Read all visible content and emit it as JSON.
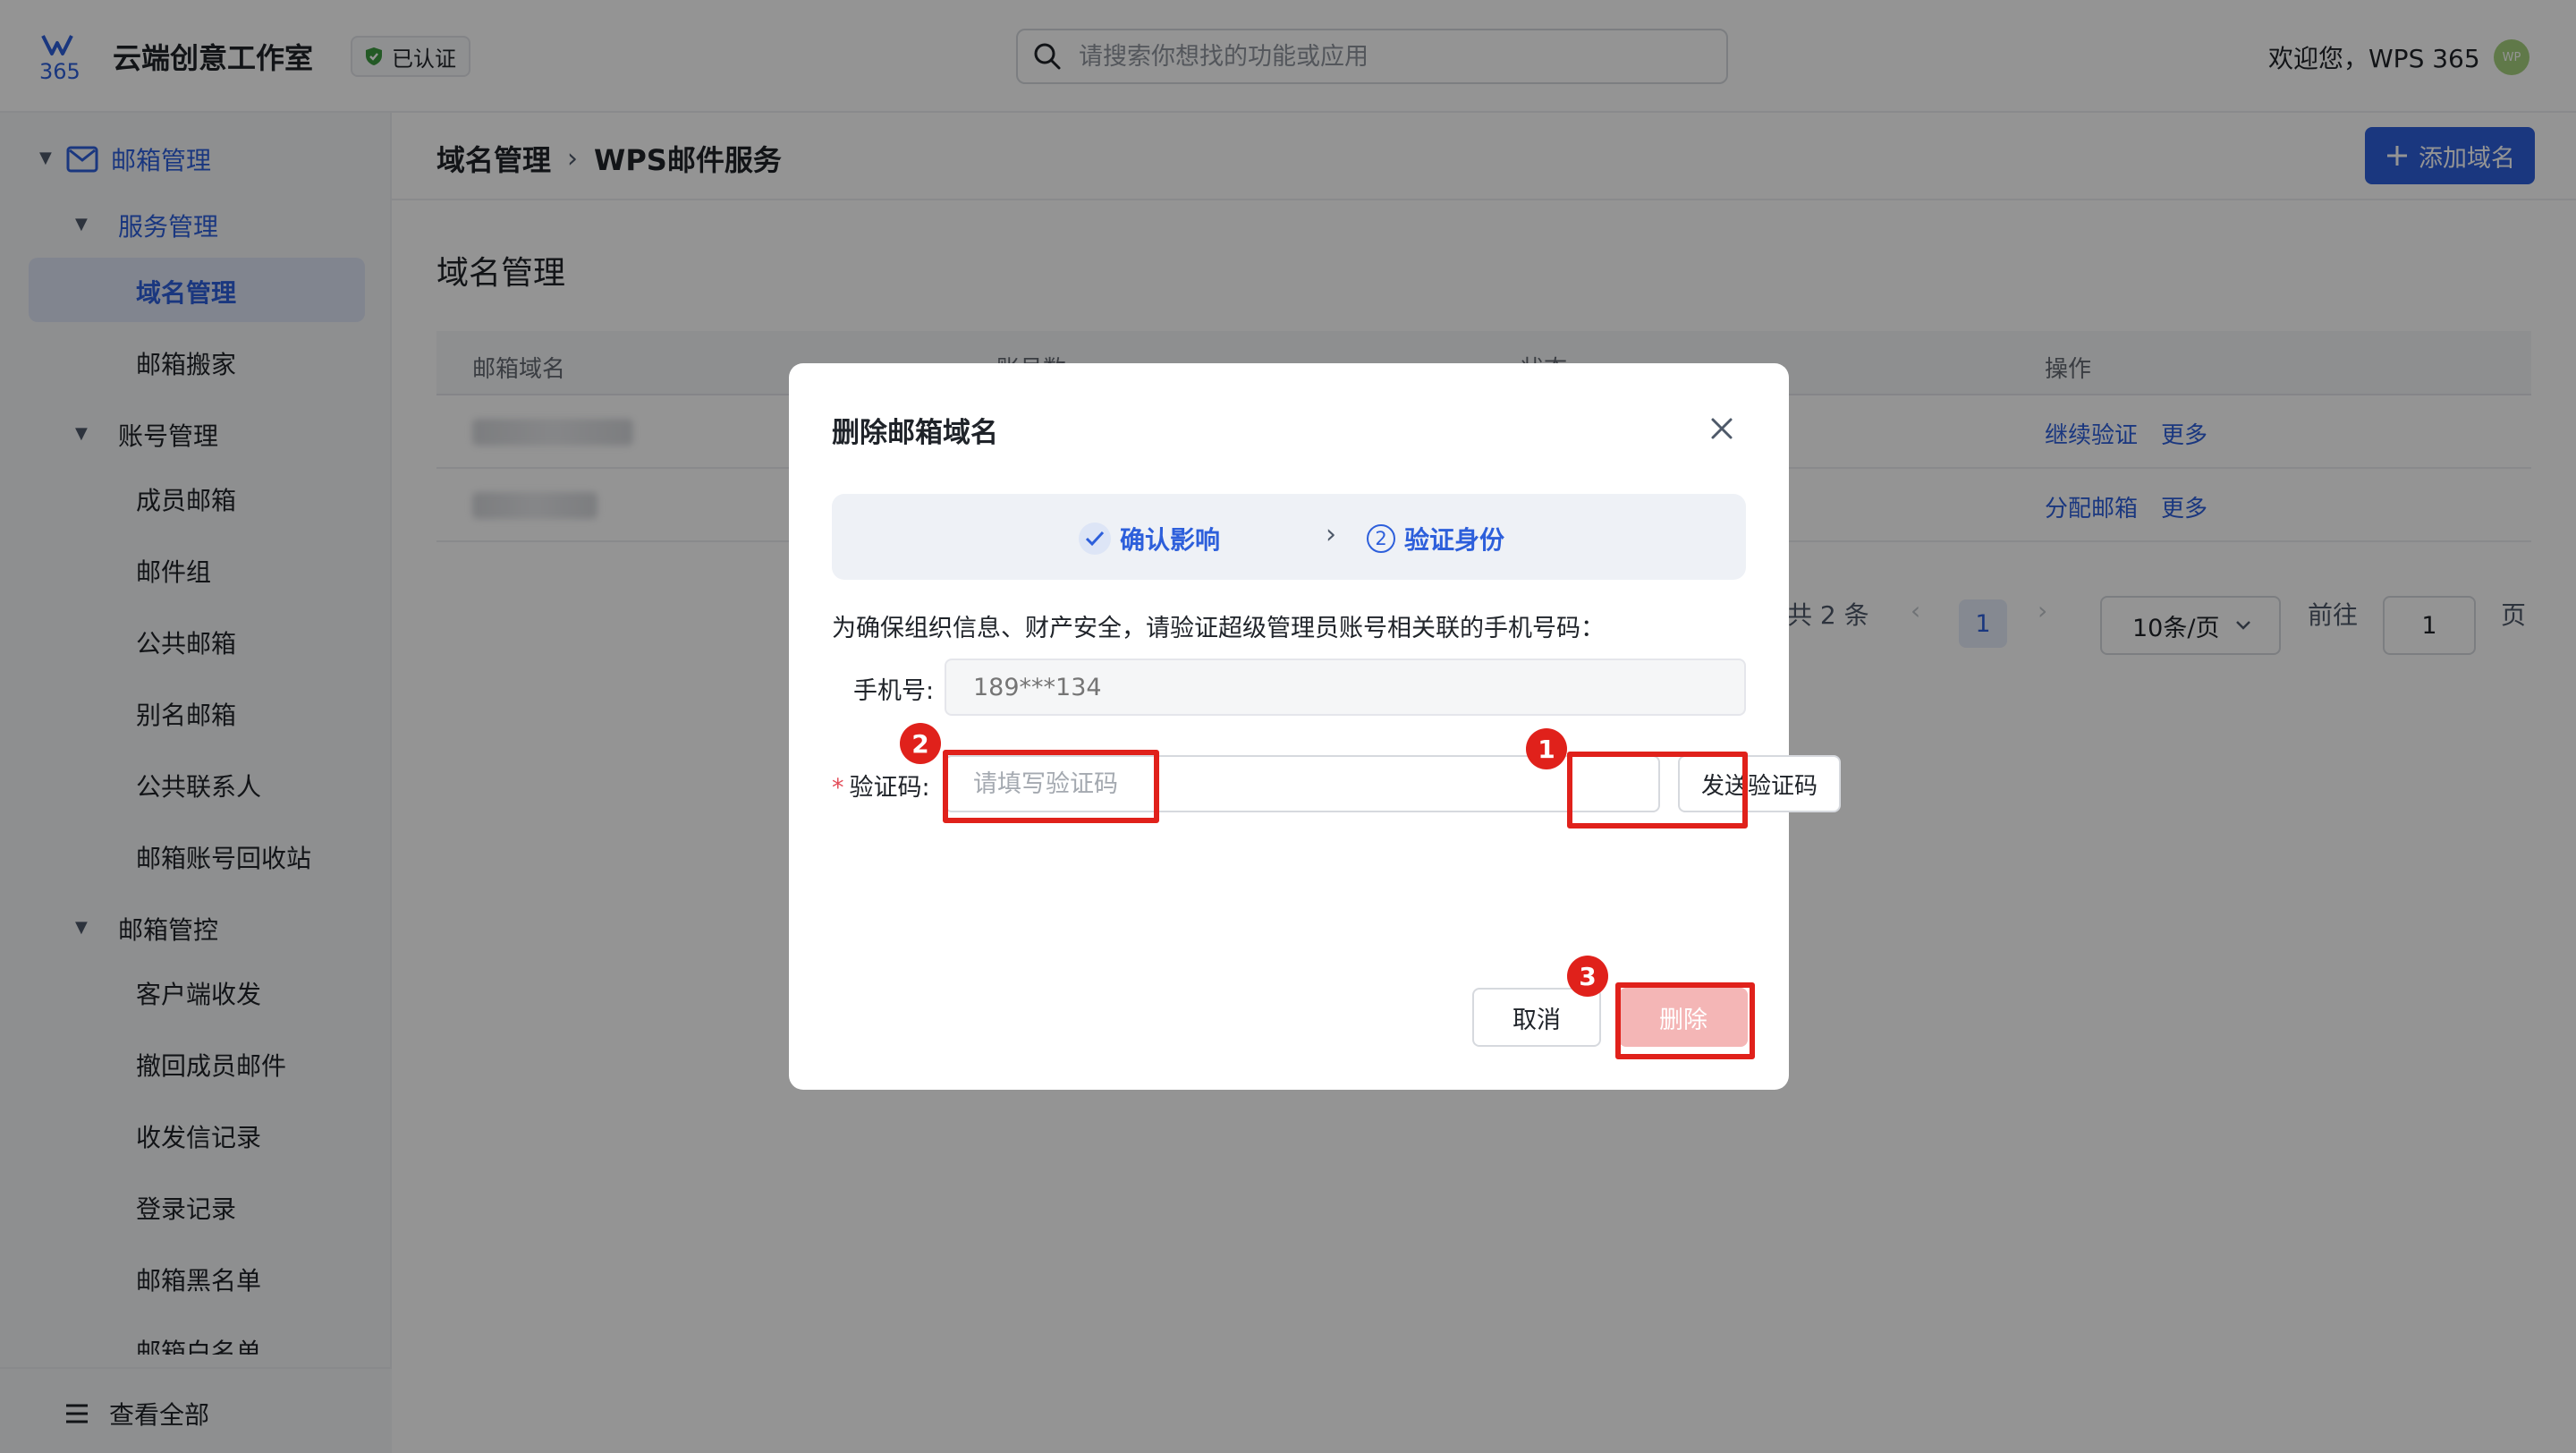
{
  "header": {
    "logo_text": "365",
    "org_name": "云端创意工作室",
    "verified_label": "已认证",
    "search_placeholder": "请搜索你想找的功能或应用",
    "welcome": "欢迎您，WPS 365",
    "avatar_text": "WP"
  },
  "sidebar": {
    "root": "邮箱管理",
    "groups": [
      {
        "label": "服务管理",
        "items": [
          "域名管理",
          "邮箱搬家"
        ]
      },
      {
        "label": "账号管理",
        "items": [
          "成员邮箱",
          "邮件组",
          "公共邮箱",
          "别名邮箱",
          "公共联系人",
          "邮箱账号回收站"
        ]
      },
      {
        "label": "邮箱管控",
        "items": [
          "客户端收发",
          "撤回成员邮件",
          "收发信记录",
          "登录记录",
          "邮箱黑名单",
          "邮箱白名单"
        ]
      }
    ],
    "footer": "查看全部"
  },
  "breadcrumb": {
    "parent": "域名管理",
    "separator": "›",
    "current": "WPS邮件服务"
  },
  "add_domain_label": "添加域名",
  "page_title": "域名管理",
  "table": {
    "columns": [
      "邮箱域名",
      "账号数",
      "状态",
      "操作"
    ],
    "rows": [
      {
        "actions": [
          "继续验证",
          "更多"
        ]
      },
      {
        "actions": [
          "分配邮箱",
          "更多"
        ]
      }
    ]
  },
  "pagination": {
    "total": "共 2 条",
    "current_page": "1",
    "page_size": "10条/页",
    "goto_label": "前往",
    "goto_value": "1",
    "page_suffix": "页"
  },
  "modal": {
    "title": "删除邮箱域名",
    "steps": [
      {
        "number": "",
        "label": "确认影响"
      },
      {
        "number": "2",
        "label": "验证身份"
      }
    ],
    "description": "为确保组织信息、财产安全，请验证超级管理员账号相关联的手机号码：",
    "phone_label": "手机号:",
    "phone_value": "189***134",
    "code_required_mark": "*",
    "code_label": "验证码:",
    "code_placeholder": "请填写验证码",
    "send_code_label": "发送验证码",
    "cancel_label": "取消",
    "delete_label": "删除"
  },
  "annotations": [
    "1",
    "2",
    "3"
  ],
  "colors": {
    "accent": "#2d5fdb",
    "highlight": "#e0211b",
    "delete_disabled": "#f4b6b6"
  }
}
